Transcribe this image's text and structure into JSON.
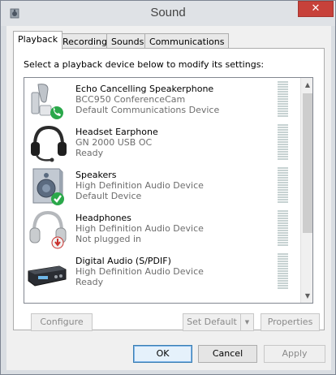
{
  "window": {
    "title": "Sound",
    "close_glyph": "✕"
  },
  "tabs": [
    {
      "label": "Playback",
      "active": true
    },
    {
      "label": "Recording",
      "active": false
    },
    {
      "label": "Sounds",
      "active": false
    },
    {
      "label": "Communications",
      "active": false
    }
  ],
  "instruction": "Select a playback device below to modify its settings:",
  "devices": [
    {
      "name": "Echo Cancelling Speakerphone",
      "description": "BCC950 ConferenceCam",
      "status": "Default Communications Device",
      "icon": "speakerphone-icon",
      "badge": "phone-badge-icon"
    },
    {
      "name": "Headset Earphone",
      "description": "GN 2000 USB OC",
      "status": "Ready",
      "icon": "headset-icon",
      "badge": ""
    },
    {
      "name": "Speakers",
      "description": "High Definition Audio Device",
      "status": "Default Device",
      "icon": "speaker-icon",
      "badge": "checkmark-badge-icon"
    },
    {
      "name": "Headphones",
      "description": "High Definition Audio Device",
      "status": "Not plugged in",
      "icon": "headphones-icon",
      "badge": "unplugged-badge-icon"
    },
    {
      "name": "Digital Audio (S/PDIF)",
      "description": "High Definition Audio Device",
      "status": "Ready",
      "icon": "digital-audio-receiver-icon",
      "badge": ""
    }
  ],
  "buttons": {
    "configure": "Configure",
    "set_default": "Set Default",
    "properties": "Properties",
    "ok": "OK",
    "cancel": "Cancel",
    "apply": "Apply"
  },
  "colors": {
    "close_button": "#c7413a",
    "badge_green": "#2aa84a",
    "badge_red": "#c9302c"
  }
}
